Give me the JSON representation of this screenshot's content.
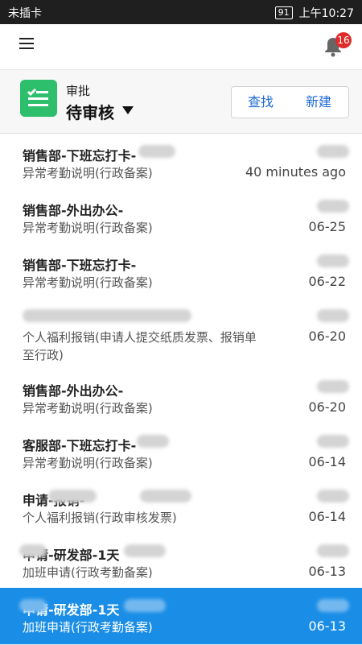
{
  "status_bar": {
    "carrier": "未插卡",
    "battery": "91",
    "time": "上午10:27"
  },
  "topbar": {
    "badge_count": "16"
  },
  "header": {
    "small_title": "审批",
    "title": "待审核",
    "search_label": "查找",
    "new_label": "新建"
  },
  "list": [
    {
      "title": "销售部-下班忘打卡-",
      "subtitle": "异常考勤说明(行政备案)",
      "date": "40 minutes ago"
    },
    {
      "title": "销售部-外出办公-",
      "subtitle": "异常考勤说明(行政备案)",
      "date": "06-25"
    },
    {
      "title": "销售部-下班忘打卡-",
      "subtitle": "异常考勤说明(行政备案)",
      "date": "06-22"
    },
    {
      "title": "",
      "subtitle": "个人福利报销(申请人提交纸质发票、报销单至行政)",
      "date": "06-20"
    },
    {
      "title": "销售部-外出办公-",
      "subtitle": "异常考勤说明(行政备案)",
      "date": "06-20"
    },
    {
      "title": "客服部-下班忘打卡-",
      "subtitle": "异常考勤说明(行政备案)",
      "date": "06-14"
    },
    {
      "title": "申请-报销-",
      "subtitle": "个人福利报销(行政审核发票)",
      "date": "06-14"
    },
    {
      "title": "申请-研发部-1天",
      "subtitle": "加班申请(行政考勤备案)",
      "date": "06-13"
    },
    {
      "title": "申请-研发部-1天",
      "subtitle": "加班申请(行政考勤备案)",
      "date": "06-13"
    }
  ]
}
